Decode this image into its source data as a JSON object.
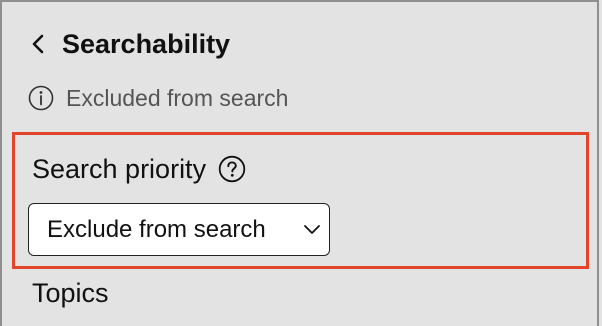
{
  "header": {
    "back_icon": "chevron-left-icon",
    "title": "Searchability"
  },
  "status": {
    "icon": "info-circle-icon",
    "text": "Excluded from search"
  },
  "priority": {
    "label": "Search priority",
    "help_icon": "question-circle-icon",
    "selected_value": "Exclude from search",
    "chevron_icon": "chevron-down-icon"
  },
  "next_section": {
    "label": "Topics"
  },
  "colors": {
    "highlight_border": "#e3452b",
    "panel_background": "#e3e3e3"
  }
}
